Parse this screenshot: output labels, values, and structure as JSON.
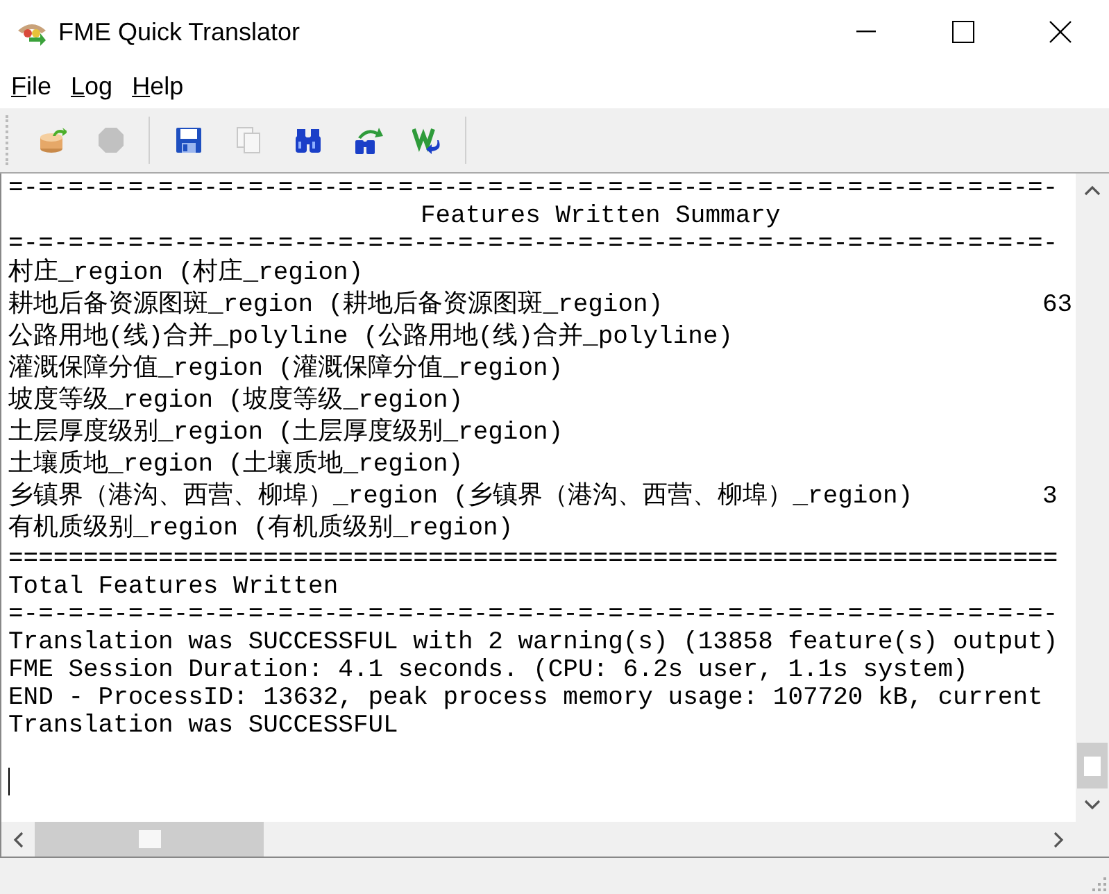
{
  "window": {
    "title": "FME Quick Translator"
  },
  "menu": [
    {
      "accel": "F",
      "rest": "ile"
    },
    {
      "accel": "L",
      "rest": "og"
    },
    {
      "accel": "H",
      "rest": "elp"
    }
  ],
  "toolbar": [
    {
      "kind": "open",
      "disabled": false
    },
    {
      "kind": "stop",
      "disabled": true
    },
    {
      "kind": "save",
      "disabled": false
    },
    {
      "kind": "copy",
      "disabled": true
    },
    {
      "kind": "find",
      "disabled": false
    },
    {
      "kind": "findnext",
      "disabled": false
    },
    {
      "kind": "workspace",
      "disabled": false
    }
  ],
  "log": [
    {
      "kind": "rule",
      "text": "=-=-=-=-=-=-=-=-=-=-=-=-=-=-=-=-=-=-=-=-=-=-=-=-=-=-=-=-=-=-=-=-=-=-=-"
    },
    {
      "kind": "heading",
      "text": "Features Written Summary"
    },
    {
      "kind": "rule",
      "text": "=-=-=-=-=-=-=-=-=-=-=-=-=-=-=-=-=-=-=-=-=-=-=-=-=-=-=-=-=-=-=-=-=-=-=-"
    },
    {
      "kind": "feature",
      "text": "村庄_region (村庄_region)"
    },
    {
      "kind": "feature",
      "text": "耕地后备资源图斑_region (耕地后备资源图斑_region)",
      "count": "63"
    },
    {
      "kind": "feature",
      "text": "公路用地(线)合并_polyline (公路用地(线)合并_polyline)"
    },
    {
      "kind": "feature",
      "text": "灌溉保障分值_region (灌溉保障分值_region)"
    },
    {
      "kind": "feature",
      "text": "坡度等级_region (坡度等级_region)"
    },
    {
      "kind": "feature",
      "text": "土层厚度级别_region (土层厚度级别_region)"
    },
    {
      "kind": "feature",
      "text": "土壤质地_region (土壤质地_region)"
    },
    {
      "kind": "feature",
      "text": "乡镇界（港沟、西营、柳埠）_region (乡镇界（港沟、西营、柳埠）_region)",
      "count": "3"
    },
    {
      "kind": "feature",
      "text": "有机质级别_region (有机质级别_region)"
    },
    {
      "kind": "rule",
      "text": "======================================================================"
    },
    {
      "kind": "text",
      "text": "Total Features Written"
    },
    {
      "kind": "rule",
      "text": "=-=-=-=-=-=-=-=-=-=-=-=-=-=-=-=-=-=-=-=-=-=-=-=-=-=-=-=-=-=-=-=-=-=-=-"
    },
    {
      "kind": "text",
      "text": "Translation was SUCCESSFUL with 2 warning(s) (13858 feature(s) output)"
    },
    {
      "kind": "text",
      "text": "FME Session Duration: 4.1 seconds. (CPU: 6.2s user, 1.1s system)"
    },
    {
      "kind": "text",
      "text": "END - ProcessID: 13632, peak process memory usage: 107720 kB, current"
    },
    {
      "kind": "text",
      "text": "Translation was SUCCESSFUL"
    }
  ]
}
